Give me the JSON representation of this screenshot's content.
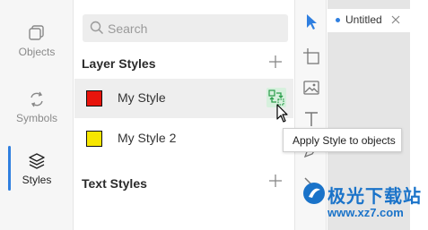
{
  "nav": {
    "items": [
      {
        "label": "Objects",
        "icon": "objects-icon"
      },
      {
        "label": "Symbols",
        "icon": "symbols-icon"
      },
      {
        "label": "Styles",
        "icon": "styles-icon",
        "active": true
      }
    ],
    "accent": "#2f7fe0"
  },
  "search": {
    "placeholder": "Search",
    "value": ""
  },
  "layer_styles": {
    "title": "Layer Styles",
    "items": [
      {
        "name": "My Style",
        "color": "#e8140c"
      },
      {
        "name": "My Style 2",
        "color": "#f7e600"
      }
    ]
  },
  "text_styles": {
    "title": "Text Styles"
  },
  "tooltip": {
    "text": "Apply Style to objects"
  },
  "tools": [
    "pointer-icon",
    "artboard-icon",
    "image-icon",
    "text-icon",
    "pen-icon",
    "line-icon"
  ],
  "tab": {
    "title": "Untitled"
  },
  "watermark": {
    "cn": "极光下载站",
    "url": "www.xz7.com"
  }
}
